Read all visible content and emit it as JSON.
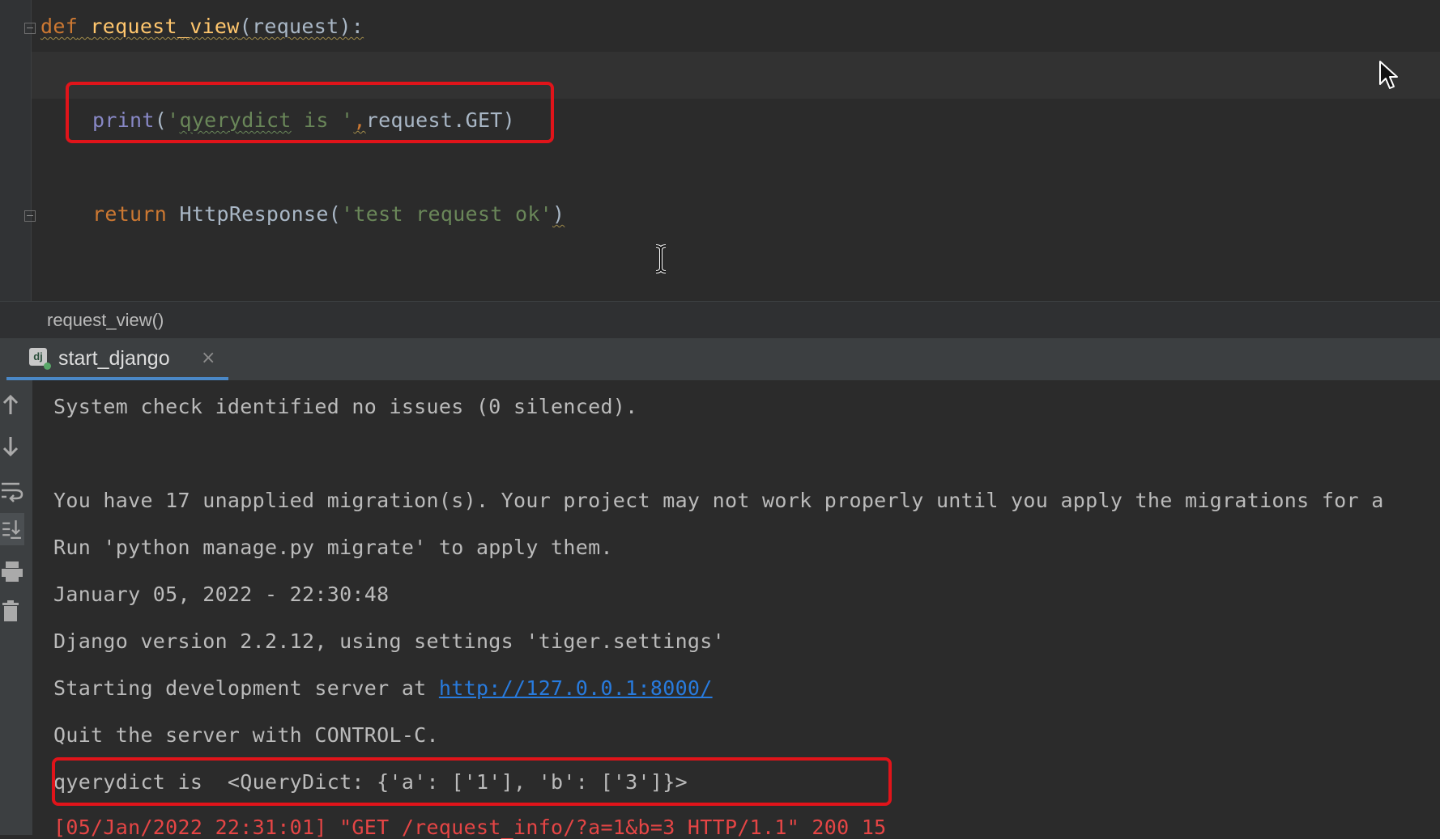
{
  "editor": {
    "lines": [
      {
        "kw": "def",
        "fn": "request_view",
        "rest": "(request):"
      },
      {
        "builtin": "print",
        "open": "(",
        "str_a": "'",
        "str_word": "qyerydict",
        "str_b": " is '",
        "comma": ",",
        "rest": "request.GET)"
      },
      {
        "kw": "return",
        "fn_plain": "HttpResponse",
        "open": "(",
        "str": "'test request ok'",
        "close": ")"
      }
    ]
  },
  "breadcrumb": {
    "label": "request_view()"
  },
  "run_tab": {
    "icon_text": "dj",
    "label": "start_django",
    "close": "×"
  },
  "console": {
    "lines": [
      "System check identified no issues (0 silenced).",
      "",
      "You have 17 unapplied migration(s). Your project may not work properly until you apply the migrations for a",
      "Run 'python manage.py migrate' to apply them.",
      "January 05, 2022 - 22:30:48",
      "Django version 2.2.12, using settings 'tiger.settings'"
    ],
    "server_prefix": "Starting development server at ",
    "server_url": "http://127.0.0.1:8000/",
    "quit_line": "Quit the server with CONTROL-C.",
    "querydict_line": "qyerydict is  <QueryDict: {'a': ['1'], 'b': ['3']}>",
    "request_log": "[05/Jan/2022 22:31:01] \"GET /request_info/?a=1&b=3 HTTP/1.1\" 200 15"
  },
  "colors": {
    "highlight_box": "#e0141a",
    "keyword": "#cc7832",
    "function": "#ffc66d",
    "string": "#6a8759",
    "link": "#287bde",
    "error": "#e54545"
  },
  "icons": [
    "arrow-up-icon",
    "arrow-down-icon",
    "soft-wrap-icon",
    "scroll-to-end-icon",
    "print-icon",
    "trash-icon"
  ]
}
